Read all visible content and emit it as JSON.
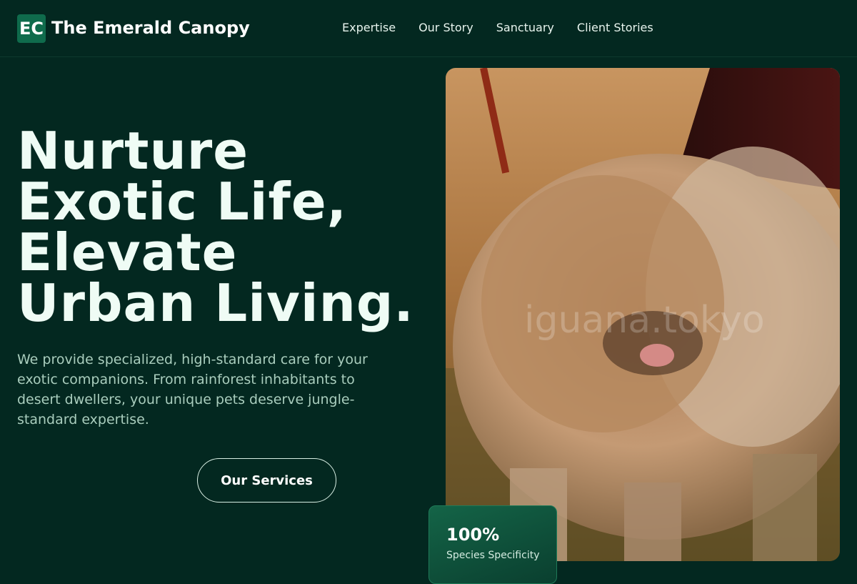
{
  "brand": {
    "badge": "EC",
    "name": "The Emerald Canopy"
  },
  "nav": {
    "items": [
      "Expertise",
      "Our Story",
      "Sanctuary",
      "Client Stories"
    ]
  },
  "hero": {
    "title_lines": [
      "Nurture",
      "Exotic Life,",
      "Elevate",
      "Urban Living."
    ],
    "description": "We provide specialized, high-standard care for your exotic companions. From rainforest inhabitants to desert dwellers, your unique pets deserve jungle-standard expertise.",
    "cta_label": "Our Services",
    "image_watermark": "iguana.tokyo"
  },
  "stat": {
    "value": "100%",
    "label": "Species Specificity"
  },
  "colors": {
    "background": "#032820",
    "accent": "#0f6b4c",
    "text": "#effcf5",
    "muted_text": "#a9cdbd"
  }
}
